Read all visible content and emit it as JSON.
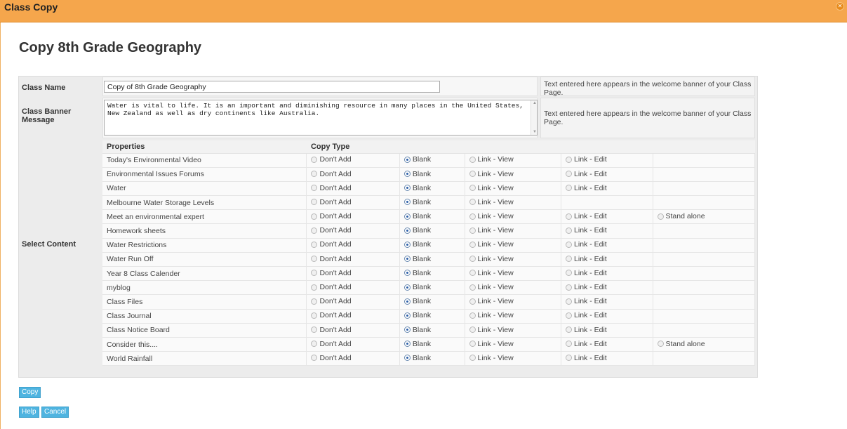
{
  "window": {
    "title": "Class Copy"
  },
  "page": {
    "heading": "Copy 8th Grade Geography"
  },
  "form": {
    "class_name_label": "Class Name",
    "class_name_value": "Copy of 8th Grade Geography",
    "class_name_help": "Text entered here appears in the welcome banner of your Class Page.",
    "banner_label": "Class Banner Message",
    "banner_value": "Water is vital to life. It is an important and diminishing resource in many places in the United States, New Zealand as well as dry continents like Australia.",
    "banner_help": "Text entered here appears in the welcome banner of your Class Page.",
    "select_content_label": "Select Content"
  },
  "content": {
    "headers": {
      "properties": "Properties",
      "copy_type": "Copy Type"
    },
    "option_labels": {
      "dont_add": "Don't Add",
      "blank": "Blank",
      "link_view": "Link - View",
      "link_edit": "Link - Edit",
      "stand_alone": "Stand alone"
    },
    "rows": [
      {
        "name": "Today's Environmental Video",
        "selected": "blank",
        "options": [
          "dont_add",
          "blank",
          "link_view",
          "link_edit"
        ]
      },
      {
        "name": "Environmental Issues Forums",
        "selected": "blank",
        "options": [
          "dont_add",
          "blank",
          "link_view",
          "link_edit"
        ]
      },
      {
        "name": "Water",
        "selected": "blank",
        "options": [
          "dont_add",
          "blank",
          "link_view",
          "link_edit"
        ]
      },
      {
        "name": "Melbourne Water Storage Levels",
        "selected": "blank",
        "options": [
          "dont_add",
          "blank",
          "link_view"
        ]
      },
      {
        "name": "Meet an environmental expert",
        "selected": "blank",
        "options": [
          "dont_add",
          "blank",
          "link_view",
          "link_edit",
          "stand_alone"
        ]
      },
      {
        "name": "Homework sheets",
        "selected": "blank",
        "options": [
          "dont_add",
          "blank",
          "link_view",
          "link_edit"
        ]
      },
      {
        "name": "Water Restrictions",
        "selected": "blank",
        "options": [
          "dont_add",
          "blank",
          "link_view",
          "link_edit"
        ]
      },
      {
        "name": "Water Run Off",
        "selected": "blank",
        "options": [
          "dont_add",
          "blank",
          "link_view",
          "link_edit"
        ]
      },
      {
        "name": "Year 8 Class Calender",
        "selected": "blank",
        "options": [
          "dont_add",
          "blank",
          "link_view",
          "link_edit"
        ]
      },
      {
        "name": "myblog",
        "selected": "blank",
        "options": [
          "dont_add",
          "blank",
          "link_view",
          "link_edit"
        ]
      },
      {
        "name": "Class Files",
        "selected": "blank",
        "options": [
          "dont_add",
          "blank",
          "link_view",
          "link_edit"
        ]
      },
      {
        "name": "Class Journal",
        "selected": "blank",
        "options": [
          "dont_add",
          "blank",
          "link_view",
          "link_edit"
        ]
      },
      {
        "name": "Class Notice Board",
        "selected": "blank",
        "options": [
          "dont_add",
          "blank",
          "link_view",
          "link_edit"
        ]
      },
      {
        "name": "Consider this....",
        "selected": "blank",
        "options": [
          "dont_add",
          "blank",
          "link_view",
          "link_edit",
          "stand_alone"
        ]
      },
      {
        "name": "World Rainfall",
        "selected": "blank",
        "options": [
          "dont_add",
          "blank",
          "link_view",
          "link_edit"
        ]
      }
    ]
  },
  "buttons": {
    "copy": "Copy",
    "help": "Help",
    "cancel": "Cancel"
  },
  "colors": {
    "title_bar": "#f5a64c",
    "button": "#4fb4e0",
    "selected_radio": "#2b5ea8"
  }
}
